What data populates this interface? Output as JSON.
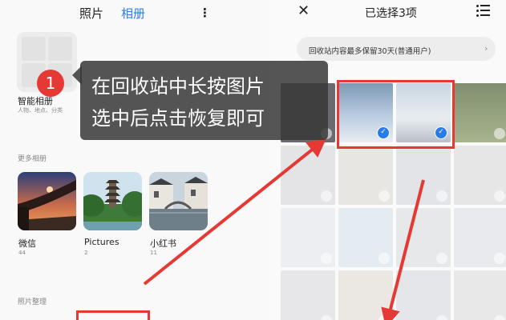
{
  "left_screen": {
    "tabs": [
      {
        "label": "照片",
        "active": false
      },
      {
        "label": "相册",
        "active": true
      }
    ],
    "menu_icon": "more-vertical-icon",
    "smart_album": {
      "title": "智能相册",
      "subtitle": "人物、地点、分类"
    },
    "more_albums_label": "更多相册",
    "albums": [
      {
        "name": "微信",
        "count": "44"
      },
      {
        "name": "Pictures",
        "count": "2"
      },
      {
        "name": "小红书",
        "count": "11"
      }
    ],
    "organize_label": "照片整理"
  },
  "right_screen": {
    "close_icon": "close-icon",
    "title": "已选择3项",
    "select_all_icon": "select-all-icon",
    "notice": "回收站内容最多保留30天(普通用户)",
    "selected_count": 3
  },
  "overlay": {
    "step_number": "1",
    "instruction_line1": "在回收站中长按图片",
    "instruction_line2": "选中后点击恢复即可"
  },
  "colors": {
    "accent_blue": "#2a7bea",
    "annotation_red": "#e53935",
    "callout_bg": "#373737"
  }
}
